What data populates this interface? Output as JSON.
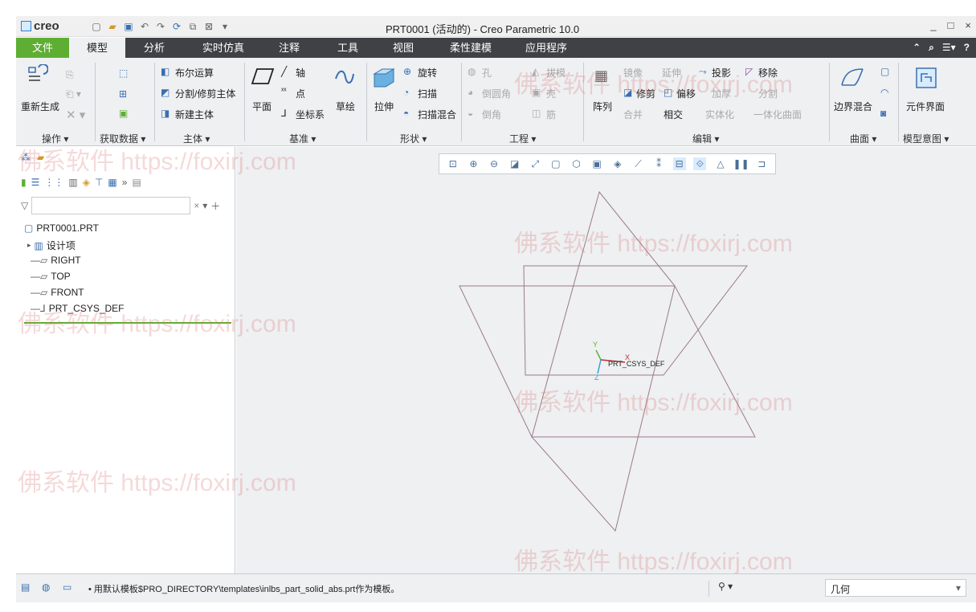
{
  "window": {
    "app_logo": "creo",
    "title": "PRT0001 (活动的) - Creo Parametric 10.0",
    "controls": [
      "_",
      "□",
      "×"
    ]
  },
  "tabs": [
    "文件",
    "模型",
    "分析",
    "实时仿真",
    "注释",
    "工具",
    "视图",
    "柔性建模",
    "应用程序"
  ],
  "ribbon": {
    "operations": {
      "regenerate": "重新生成",
      "group": "操作 ▾"
    },
    "get_data": {
      "group": "获取数据 ▾"
    },
    "body": {
      "boolean": "布尔运算",
      "split": "分割/修剪主体",
      "new_body": "新建主体",
      "group": "主体 ▾"
    },
    "datum": {
      "plane": "平面",
      "axis": "轴",
      "point": "点",
      "csys": "坐标系",
      "sketch": "草绘",
      "group": "基准 ▾"
    },
    "shapes": {
      "extrude": "拉伸",
      "revolve": "旋转",
      "sweep": "扫描",
      "swept_blend": "扫描混合",
      "group": "形状 ▾"
    },
    "engineering": {
      "hole": "孔",
      "round": "倒圆角",
      "chamfer": "倒角",
      "draft": "拔模",
      "shell": "壳",
      "rib": "筋",
      "group": "工程 ▾"
    },
    "editing": {
      "pattern": "阵列",
      "mirror": "镜像",
      "extend": "延伸",
      "project": "投影",
      "remove": "移除",
      "trim": "修剪",
      "offset": "偏移",
      "thicken": "加厚",
      "split": "分割",
      "merge": "合并",
      "intersect": "相交",
      "solidify": "实体化",
      "unify_quilts": "一体化曲面",
      "group": "编辑 ▾"
    },
    "surfaces": {
      "boundary_blend": "边界混合",
      "group": "曲面 ▾"
    },
    "model_intent": {
      "component_interface": "元件界面",
      "group": "模型意图 ▾"
    }
  },
  "tree": {
    "filter_placeholder": "",
    "items": [
      "PRT0001.PRT",
      "设计项",
      "RIGHT",
      "TOP",
      "FRONT",
      "PRT_CSYS_DEF"
    ]
  },
  "graphics": {
    "csys_label": "PRT_CSYS_DEF",
    "axis_x": "X",
    "axis_y": "Y",
    "axis_z": "Z"
  },
  "watermark": "佛系软件 https://foxirj.com",
  "status": {
    "message": "• 用默认模板$PRO_DIRECTORY\\templates\\inlbs_part_solid_abs.prt作为模板。",
    "selection_filter": "几何"
  },
  "colors": {
    "file_tab": "#5fae34",
    "tab_bar": "#3f4145",
    "ribbon_bg": "#eef0f2",
    "datum_plane": "#9c7a86"
  }
}
